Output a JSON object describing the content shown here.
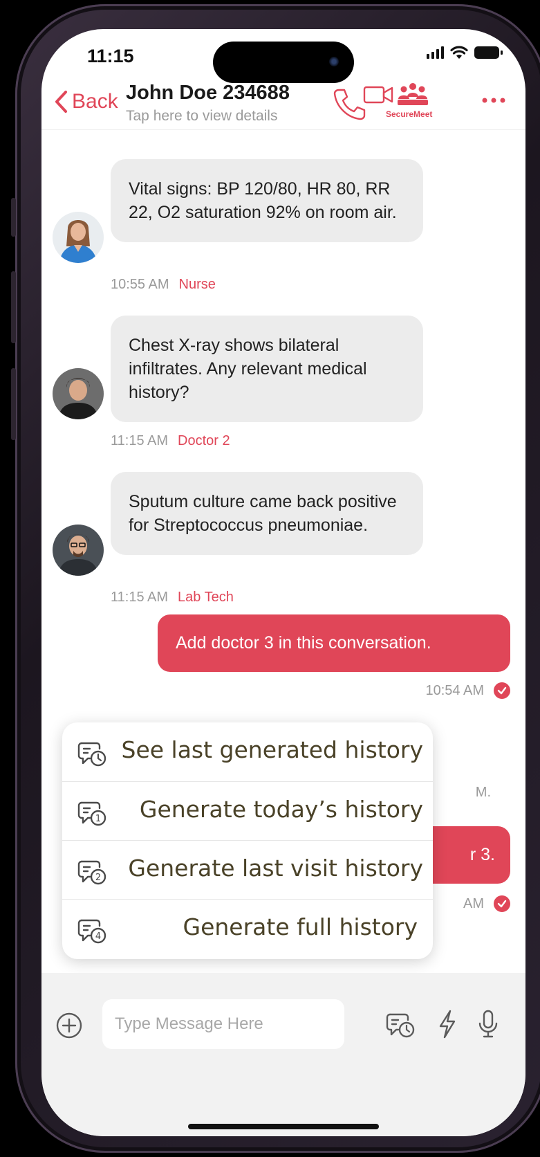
{
  "status_bar": {
    "time": "11:15"
  },
  "header": {
    "back_label": "Back",
    "contact_name": "John Doe 234688",
    "subtitle": "Tap here to view details",
    "securemeet_label": "SecureMeet"
  },
  "messages_in": [
    {
      "text": "Vital signs: BP 120/80, HR 80, RR 22, O2 saturation 92% on room air.",
      "time": "10:55 AM",
      "sender": "Nurse"
    },
    {
      "text": "Chest X-ray shows bilateral infiltrates. Any relevant medical history?",
      "time": "11:15 AM",
      "sender": "Doctor 2"
    },
    {
      "text": "Sputum culture came back positive for Streptococcus pneumoniae.",
      "time": "11:15 AM",
      "sender": "Lab Tech"
    }
  ],
  "messages_out": [
    {
      "text": "Add doctor 3 in this conversation.",
      "time": "10:54 AM"
    },
    {
      "text_partial": "r 3.",
      "time_partial_top": "M.",
      "time_partial": "AM"
    }
  ],
  "history_menu": [
    {
      "label": "See last generated history",
      "icon": "history-clock-icon"
    },
    {
      "label": "Generate today’s history",
      "icon": "history-1-icon"
    },
    {
      "label": "Generate last visit history",
      "icon": "history-2-icon"
    },
    {
      "label": "Generate full history",
      "icon": "history-4-icon"
    }
  ],
  "composer": {
    "placeholder": "Type Message Here"
  },
  "colors": {
    "accent": "#e04658",
    "bubble_in": "#ececec",
    "menu_text": "#4a4228"
  }
}
